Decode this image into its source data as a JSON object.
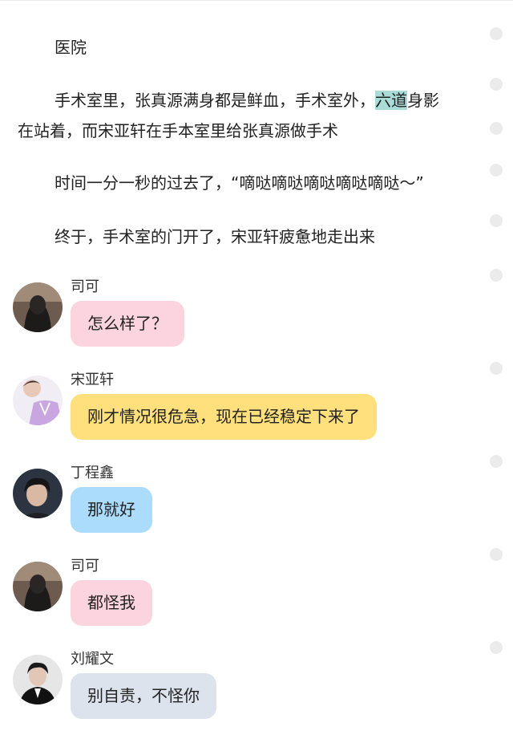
{
  "story": {
    "heading": "医院",
    "p1": {
      "before": "手术室里，张真源满身都是鲜血，手术室外，",
      "highlight": "六道",
      "after": "身影",
      "line2": "在站着，而宋亚轩在手本室里给张真源做手术"
    },
    "p2": "时间一分一秒的过去了，“嘀哒嘀哒嘀哒嘀哒嘀哒～”",
    "p3": "终于，手术室的门开了，宋亚轩疲惫地走出来"
  },
  "messages": [
    {
      "name": "司可",
      "text": "怎么样了？",
      "bubble_color": "#fcd4df",
      "avatar": "dark-girl-avatar"
    },
    {
      "name": "宋亚轩",
      "text": "刚才情况很危急，现在已经稳定下来了",
      "bubble_color": "#ffe07c",
      "avatar": "purple-vest-boy-avatar"
    },
    {
      "name": "丁程鑫",
      "text": "那就好",
      "bubble_color": "#abdcfc",
      "avatar": "dark-hair-boy-avatar"
    },
    {
      "name": "司可",
      "text": "都怪我",
      "bubble_color": "#fcd4df",
      "avatar": "dark-girl-avatar"
    },
    {
      "name": "刘耀文",
      "text": "别自责，不怪你",
      "bubble_color": "#dde3ec",
      "avatar": "suit-boy-avatar"
    }
  ],
  "colors": {
    "highlight": "#a9dcd7",
    "side_dot": "#ebebeb"
  }
}
